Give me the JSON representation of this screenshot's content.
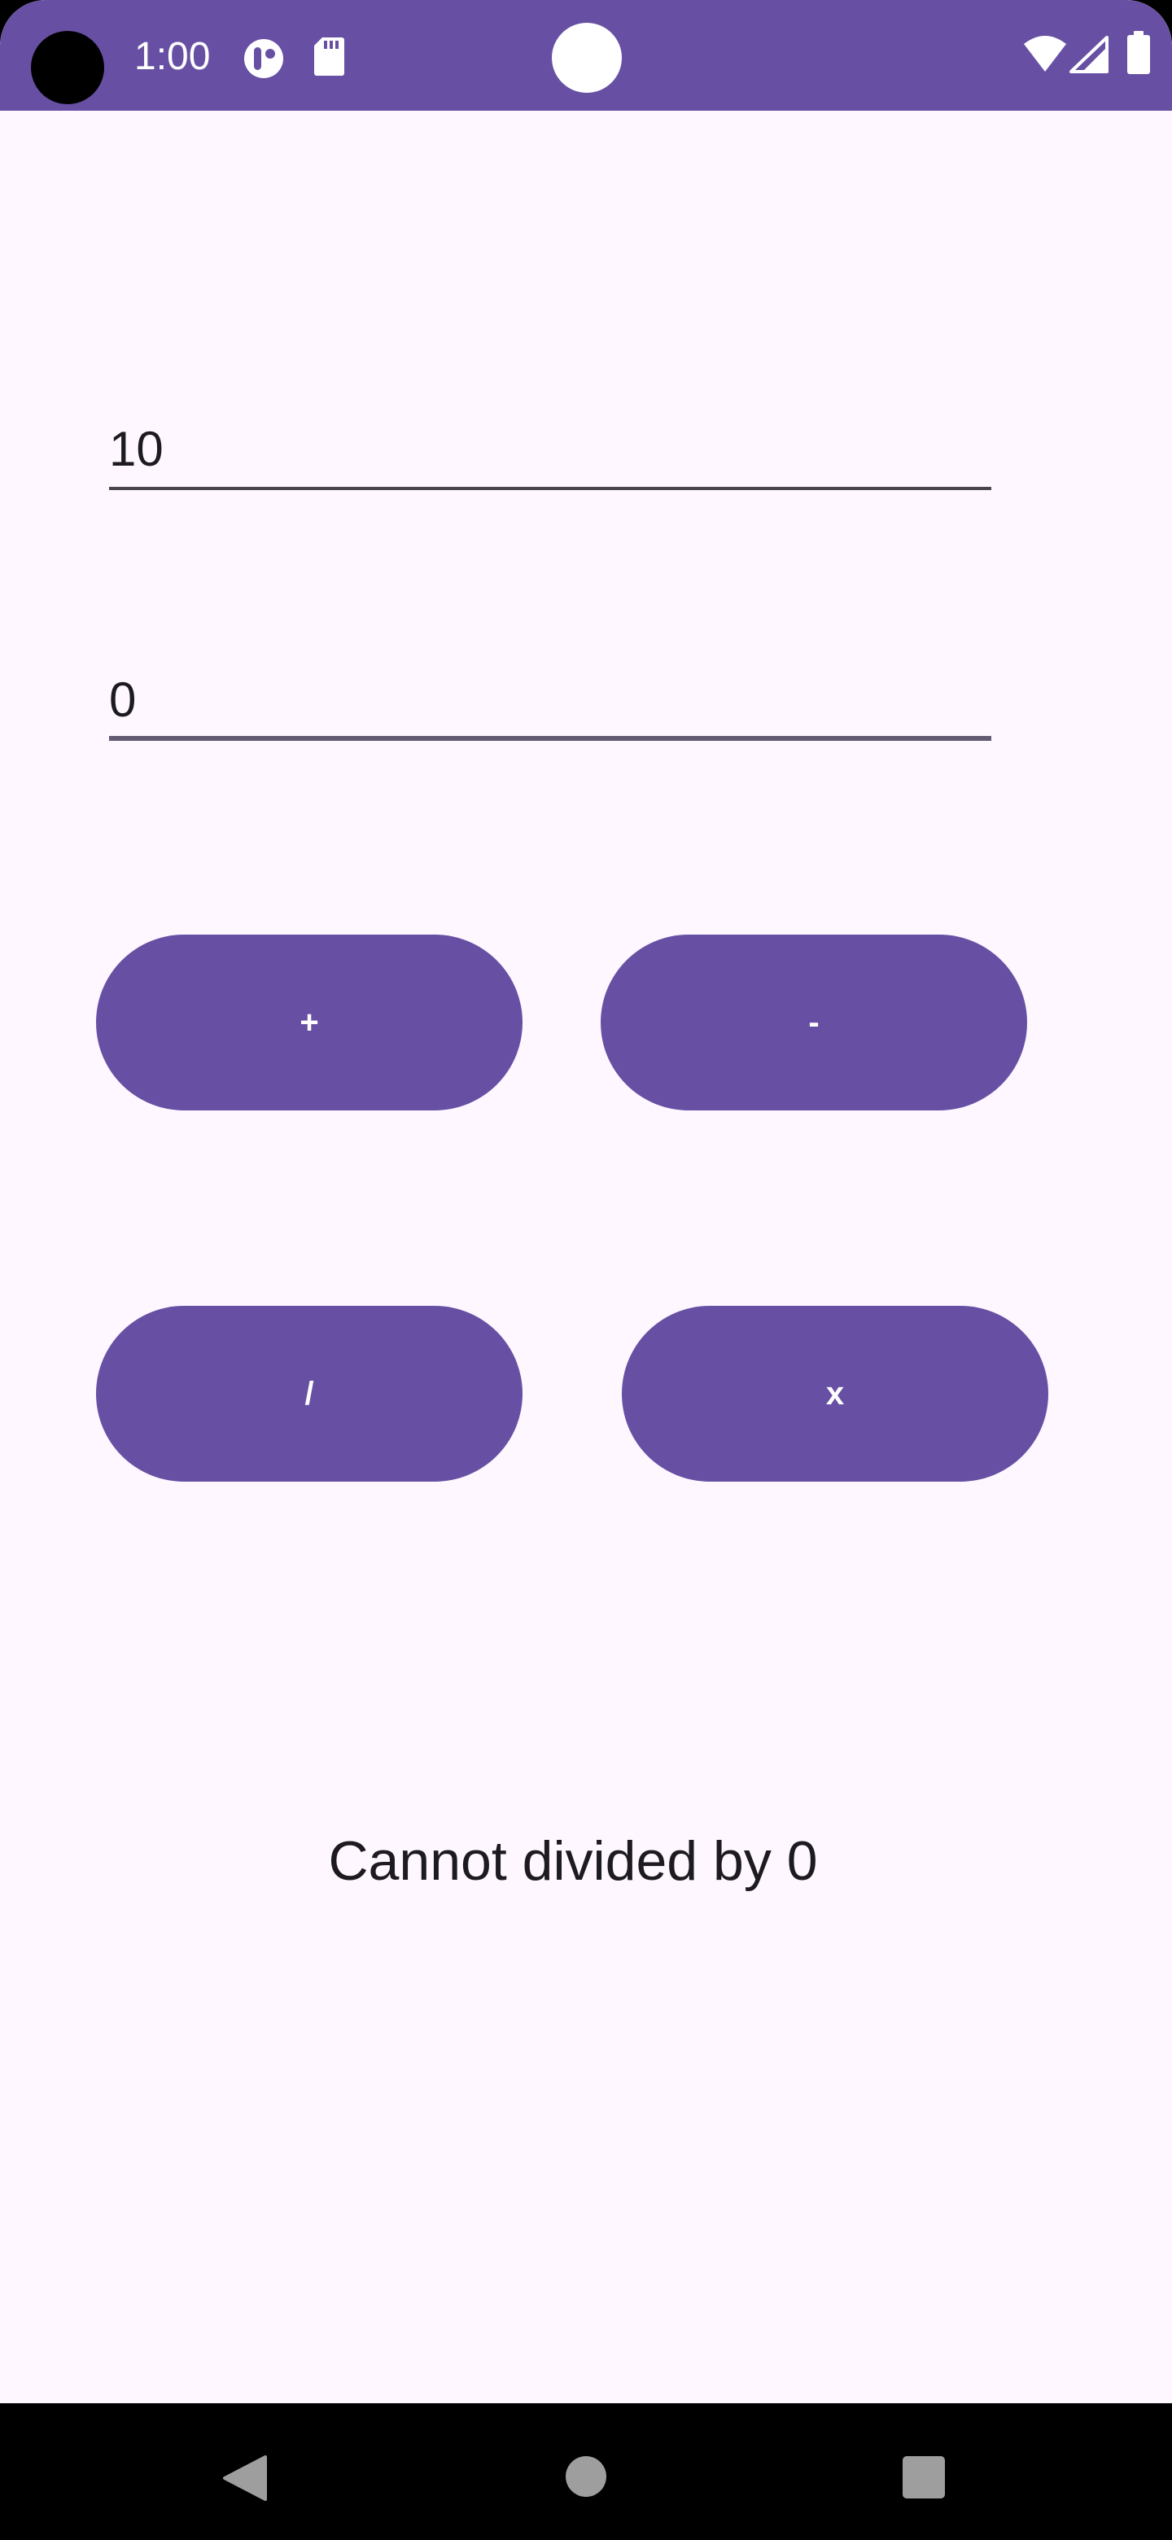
{
  "status_bar": {
    "time": "1:00",
    "icons": [
      "camera-cutout-icon",
      "tracking-icon",
      "sd-card-icon",
      "center-dot-icon",
      "wifi-icon",
      "signal-icon",
      "battery-icon"
    ],
    "color": "#6750A4"
  },
  "inputs": {
    "first_value": "10",
    "second_value": "0"
  },
  "buttons": {
    "add": "+",
    "subtract": "-",
    "divide": "/",
    "multiply": "x"
  },
  "result_text": "Cannot divided by 0",
  "nav_bar": {
    "icons": [
      "back-icon",
      "home-icon",
      "recents-icon"
    ]
  },
  "colors": {
    "primary": "#6750A4",
    "background": "#FEF7FF"
  }
}
